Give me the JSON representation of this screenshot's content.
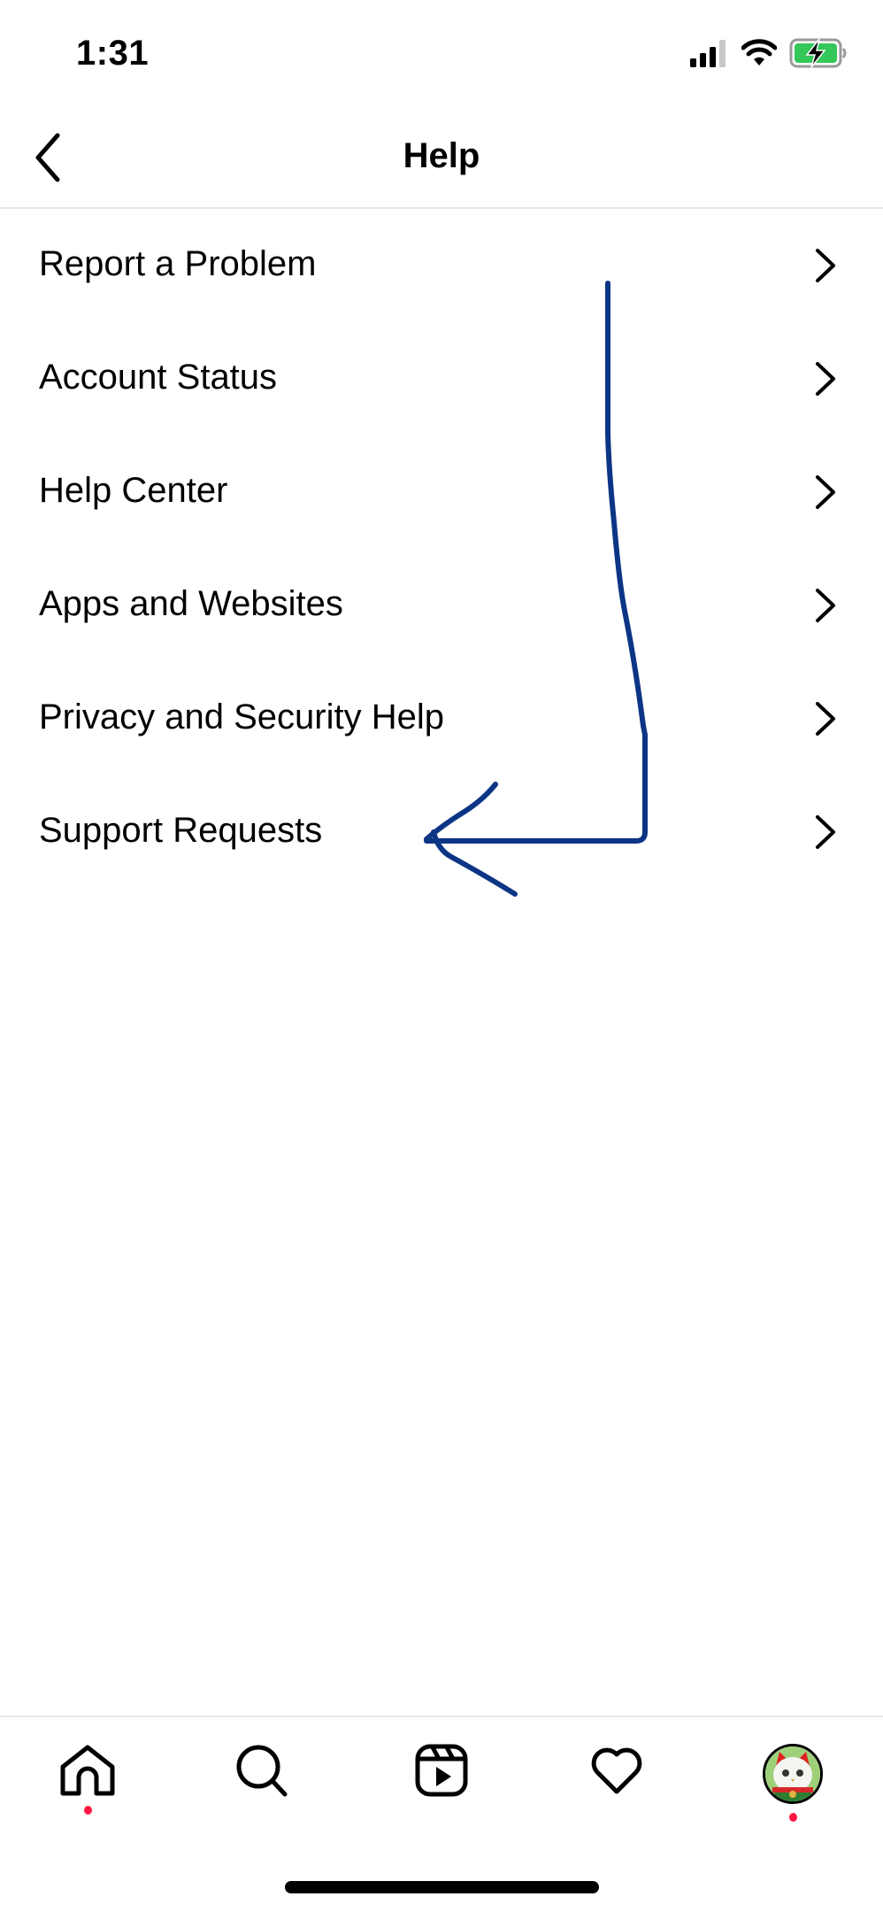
{
  "status_bar": {
    "time": "1:31",
    "signal_icon": "cellular-signal-icon",
    "wifi_icon": "wifi-icon",
    "battery_icon": "battery-charging-icon",
    "battery_color": "#34c759"
  },
  "header": {
    "title": "Help",
    "back_icon": "chevron-left-icon"
  },
  "menu": {
    "items": [
      {
        "label": "Report a Problem"
      },
      {
        "label": "Account Status"
      },
      {
        "label": "Help Center"
      },
      {
        "label": "Apps and Websites"
      },
      {
        "label": "Privacy and Security Help"
      },
      {
        "label": "Support Requests"
      }
    ],
    "chevron_icon": "chevron-right-icon"
  },
  "annotation": {
    "type": "hand-drawn-arrow",
    "points_to": "Support Requests",
    "color": "#0d3585"
  },
  "tab_bar": {
    "tabs": [
      {
        "name": "home",
        "icon": "home-icon",
        "notification_dot": true
      },
      {
        "name": "search",
        "icon": "search-icon",
        "notification_dot": false
      },
      {
        "name": "reels",
        "icon": "reels-icon",
        "notification_dot": false
      },
      {
        "name": "activity",
        "icon": "heart-icon",
        "notification_dot": false
      },
      {
        "name": "profile",
        "icon": "avatar",
        "notification_dot": true
      }
    ],
    "dot_color": "#ff1744"
  }
}
